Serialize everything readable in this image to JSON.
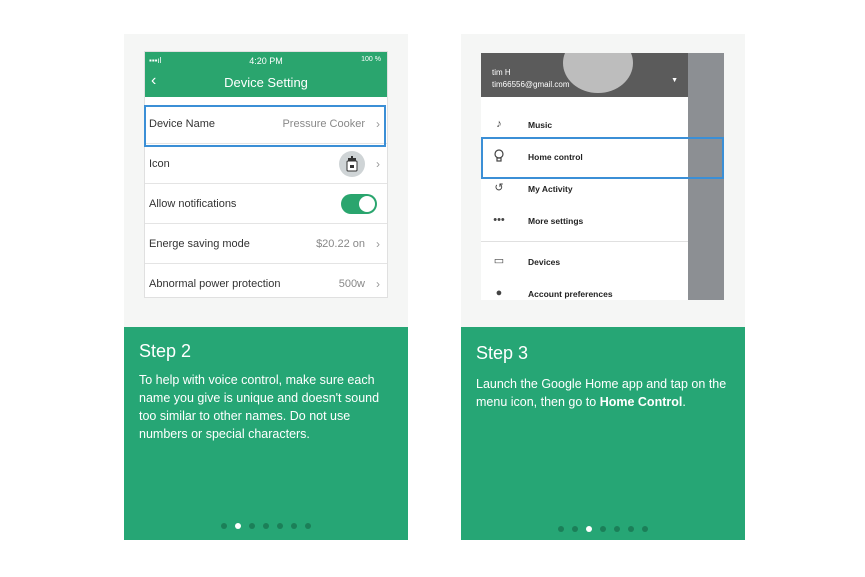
{
  "left_card": {
    "phone": {
      "status_time": "4:20  PM",
      "status_battery": "100 %",
      "title": "Device Setting",
      "rows": [
        {
          "label": "Device Name",
          "value": "Pressure Cooker"
        },
        {
          "label": "Icon",
          "value": ""
        },
        {
          "label": "Allow notifications",
          "value": ""
        },
        {
          "label": "Energe saving mode",
          "value": "$20.22  on"
        },
        {
          "label": "Abnormal power protection",
          "value": "500w"
        }
      ]
    },
    "step_title": "Step 2",
    "step_text": "To help with voice control, make sure each name you give is unique and doesn't sound too similar to other names. Do not use numbers or special characters.",
    "dots_total": 7,
    "active_dot": 1
  },
  "right_card": {
    "drawer": {
      "user_name": "tim H",
      "user_email": "tim66556@gmail.com",
      "items": [
        {
          "icon": "music-note-icon",
          "label": "Music"
        },
        {
          "icon": "lightbulb-icon",
          "label": "Home control"
        },
        {
          "icon": "history-icon",
          "label": "My Activity"
        },
        {
          "icon": "more-horiz-icon",
          "label": "More settings"
        },
        {
          "icon": "devices-icon",
          "label": "Devices"
        },
        {
          "icon": "account-icon",
          "label": "Account preferences"
        }
      ]
    },
    "step_title": "Step 3",
    "step_text_pre": "Launch the Google Home app and tap on the menu icon, then go to ",
    "step_text_bold": "Home Control",
    "step_text_post": ".",
    "dots_total": 7,
    "active_dot": 2
  },
  "colors": {
    "green": "#26a675",
    "highlight_blue": "#3b8fd6"
  }
}
